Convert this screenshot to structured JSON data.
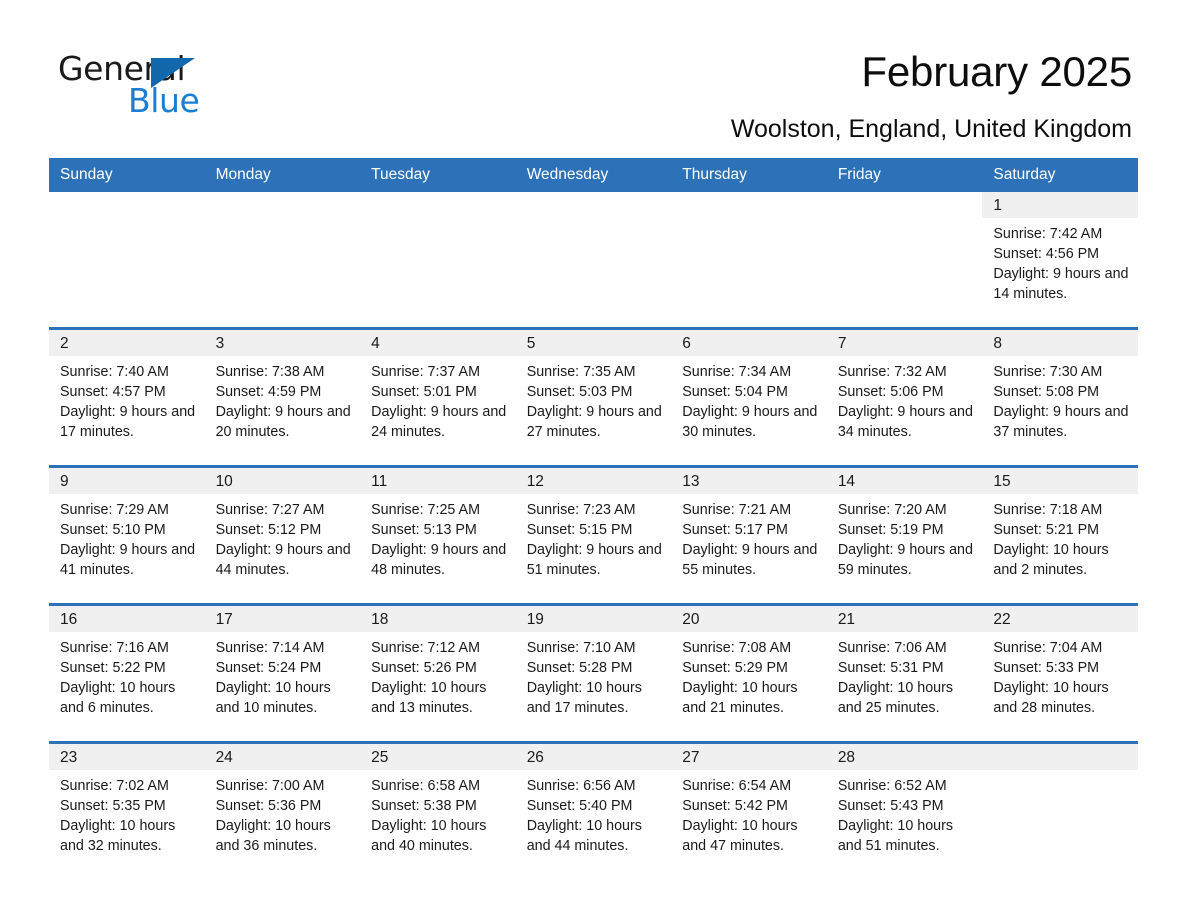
{
  "brand": {
    "name_top": "General",
    "name_bottom": "Blue",
    "triangle_color": "#1168ad",
    "blue_text_color": "#1a7fd4"
  },
  "header": {
    "title": "February 2025",
    "location": "Woolston, England, United Kingdom",
    "accent_color": "#2d72b8",
    "band_color": "#f0f0f0"
  },
  "weekday_headers": [
    "Sunday",
    "Monday",
    "Tuesday",
    "Wednesday",
    "Thursday",
    "Friday",
    "Saturday"
  ],
  "labels": {
    "sunrise_prefix": "Sunrise: ",
    "sunset_prefix": "Sunset: ",
    "daylight_prefix": "Daylight: "
  },
  "weeks": [
    [
      {
        "day": "",
        "sunrise": "",
        "sunset": "",
        "daylight": "",
        "blank": true
      },
      {
        "day": "",
        "sunrise": "",
        "sunset": "",
        "daylight": "",
        "blank": true
      },
      {
        "day": "",
        "sunrise": "",
        "sunset": "",
        "daylight": "",
        "blank": true
      },
      {
        "day": "",
        "sunrise": "",
        "sunset": "",
        "daylight": "",
        "blank": true
      },
      {
        "day": "",
        "sunrise": "",
        "sunset": "",
        "daylight": "",
        "blank": true
      },
      {
        "day": "",
        "sunrise": "",
        "sunset": "",
        "daylight": "",
        "blank": true
      },
      {
        "day": "1",
        "sunrise": "Sunrise: 7:42 AM",
        "sunset": "Sunset: 4:56 PM",
        "daylight": "Daylight: 9 hours and 14 minutes."
      }
    ],
    [
      {
        "day": "2",
        "sunrise": "Sunrise: 7:40 AM",
        "sunset": "Sunset: 4:57 PM",
        "daylight": "Daylight: 9 hours and 17 minutes."
      },
      {
        "day": "3",
        "sunrise": "Sunrise: 7:38 AM",
        "sunset": "Sunset: 4:59 PM",
        "daylight": "Daylight: 9 hours and 20 minutes."
      },
      {
        "day": "4",
        "sunrise": "Sunrise: 7:37 AM",
        "sunset": "Sunset: 5:01 PM",
        "daylight": "Daylight: 9 hours and 24 minutes."
      },
      {
        "day": "5",
        "sunrise": "Sunrise: 7:35 AM",
        "sunset": "Sunset: 5:03 PM",
        "daylight": "Daylight: 9 hours and 27 minutes."
      },
      {
        "day": "6",
        "sunrise": "Sunrise: 7:34 AM",
        "sunset": "Sunset: 5:04 PM",
        "daylight": "Daylight: 9 hours and 30 minutes."
      },
      {
        "day": "7",
        "sunrise": "Sunrise: 7:32 AM",
        "sunset": "Sunset: 5:06 PM",
        "daylight": "Daylight: 9 hours and 34 minutes."
      },
      {
        "day": "8",
        "sunrise": "Sunrise: 7:30 AM",
        "sunset": "Sunset: 5:08 PM",
        "daylight": "Daylight: 9 hours and 37 minutes."
      }
    ],
    [
      {
        "day": "9",
        "sunrise": "Sunrise: 7:29 AM",
        "sunset": "Sunset: 5:10 PM",
        "daylight": "Daylight: 9 hours and 41 minutes."
      },
      {
        "day": "10",
        "sunrise": "Sunrise: 7:27 AM",
        "sunset": "Sunset: 5:12 PM",
        "daylight": "Daylight: 9 hours and 44 minutes."
      },
      {
        "day": "11",
        "sunrise": "Sunrise: 7:25 AM",
        "sunset": "Sunset: 5:13 PM",
        "daylight": "Daylight: 9 hours and 48 minutes."
      },
      {
        "day": "12",
        "sunrise": "Sunrise: 7:23 AM",
        "sunset": "Sunset: 5:15 PM",
        "daylight": "Daylight: 9 hours and 51 minutes."
      },
      {
        "day": "13",
        "sunrise": "Sunrise: 7:21 AM",
        "sunset": "Sunset: 5:17 PM",
        "daylight": "Daylight: 9 hours and 55 minutes."
      },
      {
        "day": "14",
        "sunrise": "Sunrise: 7:20 AM",
        "sunset": "Sunset: 5:19 PM",
        "daylight": "Daylight: 9 hours and 59 minutes."
      },
      {
        "day": "15",
        "sunrise": "Sunrise: 7:18 AM",
        "sunset": "Sunset: 5:21 PM",
        "daylight": "Daylight: 10 hours and 2 minutes."
      }
    ],
    [
      {
        "day": "16",
        "sunrise": "Sunrise: 7:16 AM",
        "sunset": "Sunset: 5:22 PM",
        "daylight": "Daylight: 10 hours and 6 minutes."
      },
      {
        "day": "17",
        "sunrise": "Sunrise: 7:14 AM",
        "sunset": "Sunset: 5:24 PM",
        "daylight": "Daylight: 10 hours and 10 minutes."
      },
      {
        "day": "18",
        "sunrise": "Sunrise: 7:12 AM",
        "sunset": "Sunset: 5:26 PM",
        "daylight": "Daylight: 10 hours and 13 minutes."
      },
      {
        "day": "19",
        "sunrise": "Sunrise: 7:10 AM",
        "sunset": "Sunset: 5:28 PM",
        "daylight": "Daylight: 10 hours and 17 minutes."
      },
      {
        "day": "20",
        "sunrise": "Sunrise: 7:08 AM",
        "sunset": "Sunset: 5:29 PM",
        "daylight": "Daylight: 10 hours and 21 minutes."
      },
      {
        "day": "21",
        "sunrise": "Sunrise: 7:06 AM",
        "sunset": "Sunset: 5:31 PM",
        "daylight": "Daylight: 10 hours and 25 minutes."
      },
      {
        "day": "22",
        "sunrise": "Sunrise: 7:04 AM",
        "sunset": "Sunset: 5:33 PM",
        "daylight": "Daylight: 10 hours and 28 minutes."
      }
    ],
    [
      {
        "day": "23",
        "sunrise": "Sunrise: 7:02 AM",
        "sunset": "Sunset: 5:35 PM",
        "daylight": "Daylight: 10 hours and 32 minutes."
      },
      {
        "day": "24",
        "sunrise": "Sunrise: 7:00 AM",
        "sunset": "Sunset: 5:36 PM",
        "daylight": "Daylight: 10 hours and 36 minutes."
      },
      {
        "day": "25",
        "sunrise": "Sunrise: 6:58 AM",
        "sunset": "Sunset: 5:38 PM",
        "daylight": "Daylight: 10 hours and 40 minutes."
      },
      {
        "day": "26",
        "sunrise": "Sunrise: 6:56 AM",
        "sunset": "Sunset: 5:40 PM",
        "daylight": "Daylight: 10 hours and 44 minutes."
      },
      {
        "day": "27",
        "sunrise": "Sunrise: 6:54 AM",
        "sunset": "Sunset: 5:42 PM",
        "daylight": "Daylight: 10 hours and 47 minutes."
      },
      {
        "day": "28",
        "sunrise": "Sunrise: 6:52 AM",
        "sunset": "Sunset: 5:43 PM",
        "daylight": "Daylight: 10 hours and 51 minutes."
      },
      {
        "day": "",
        "sunrise": "",
        "sunset": "",
        "daylight": "",
        "blank": true
      }
    ]
  ]
}
